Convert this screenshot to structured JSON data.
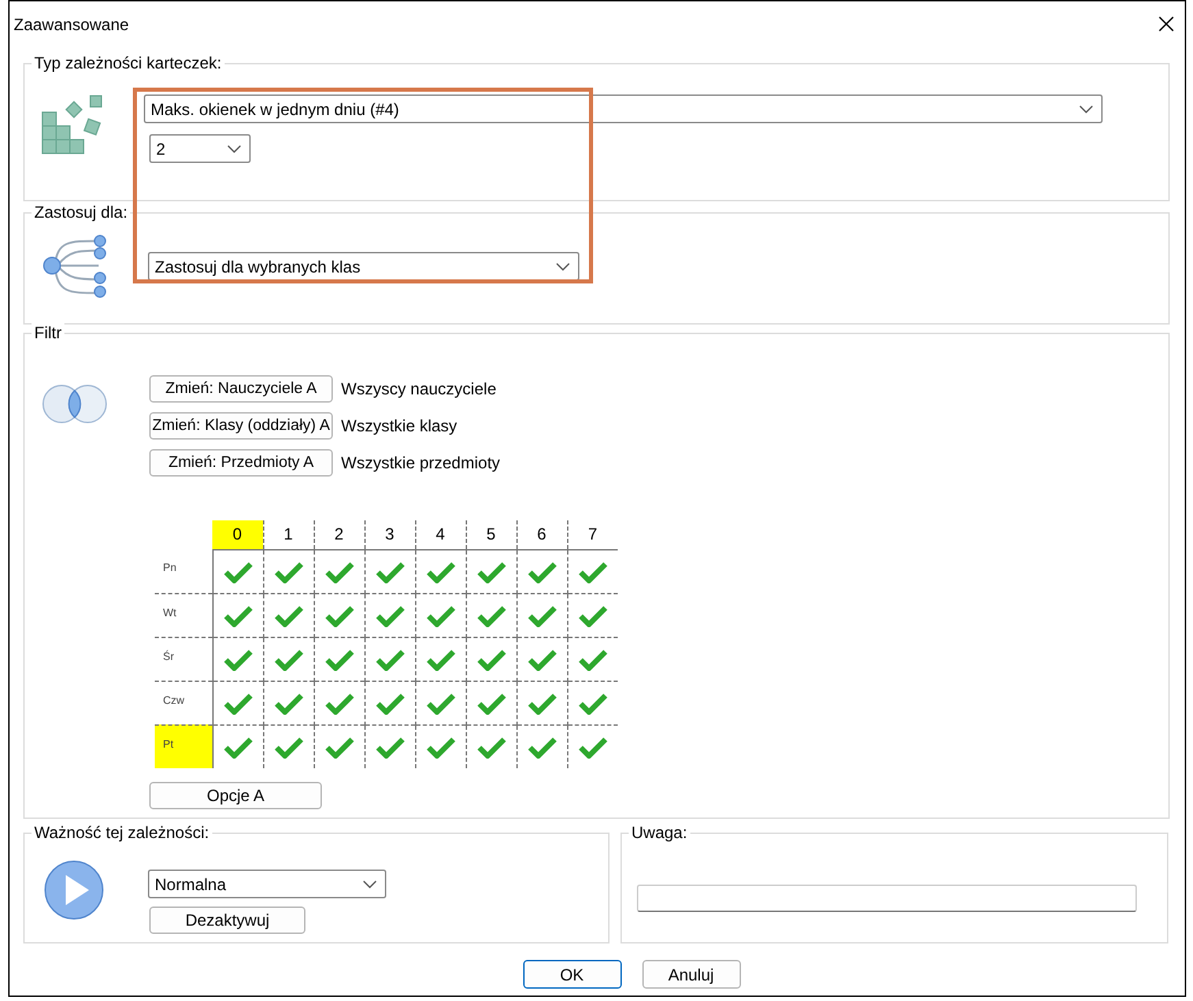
{
  "window": {
    "title": "Zaawansowane"
  },
  "type_group": {
    "legend": "Typ zależności karteczek:",
    "type_select": "Maks. okienek w jednym dniu (#4)",
    "value_select": "2"
  },
  "apply_group": {
    "legend": "Zastosuj dla:",
    "apply_select": "Zastosuj dla wybranych klas"
  },
  "filter": {
    "legend": "Filtr",
    "filters": [
      {
        "button": "Zmień: Nauczyciele A",
        "value": "Wszyscy nauczyciele"
      },
      {
        "button": "Zmień: Klasy (oddziały) A",
        "value": "Wszystkie klasy"
      },
      {
        "button": "Zmień: Przedmioty A",
        "value": "Wszystkie przedmioty"
      }
    ],
    "grid": {
      "columns": [
        {
          "label": "0",
          "selected": true
        },
        {
          "label": "1",
          "selected": false
        },
        {
          "label": "2",
          "selected": false
        },
        {
          "label": "3",
          "selected": false
        },
        {
          "label": "4",
          "selected": false
        },
        {
          "label": "5",
          "selected": false
        },
        {
          "label": "6",
          "selected": false
        },
        {
          "label": "7",
          "selected": false
        }
      ],
      "rows": [
        {
          "label": "Pn",
          "selected": false,
          "cells": [
            {
              "checked": true
            },
            {
              "checked": true
            },
            {
              "checked": true
            },
            {
              "checked": true
            },
            {
              "checked": true
            },
            {
              "checked": true
            },
            {
              "checked": true
            },
            {
              "checked": true
            }
          ]
        },
        {
          "label": "Wt",
          "selected": false,
          "cells": [
            {
              "checked": true
            },
            {
              "checked": true
            },
            {
              "checked": true
            },
            {
              "checked": true
            },
            {
              "checked": true
            },
            {
              "checked": true
            },
            {
              "checked": true
            },
            {
              "checked": true
            }
          ]
        },
        {
          "label": "Śr",
          "selected": false,
          "cells": [
            {
              "checked": true
            },
            {
              "checked": true
            },
            {
              "checked": true
            },
            {
              "checked": true
            },
            {
              "checked": true
            },
            {
              "checked": true
            },
            {
              "checked": true
            },
            {
              "checked": true
            }
          ]
        },
        {
          "label": "Czw",
          "selected": false,
          "cells": [
            {
              "checked": true
            },
            {
              "checked": true
            },
            {
              "checked": true
            },
            {
              "checked": true
            },
            {
              "checked": true
            },
            {
              "checked": true
            },
            {
              "checked": true
            },
            {
              "checked": true
            }
          ]
        },
        {
          "label": "Pt",
          "selected": true,
          "cells": [
            {
              "checked": true
            },
            {
              "checked": true
            },
            {
              "checked": true
            },
            {
              "checked": true
            },
            {
              "checked": true
            },
            {
              "checked": true
            },
            {
              "checked": true
            },
            {
              "checked": true
            }
          ]
        }
      ]
    },
    "options_button": "Opcje A"
  },
  "importance": {
    "legend": "Ważność tej zależności:",
    "select": "Normalna",
    "deactivate_button": "Dezaktywuj"
  },
  "note": {
    "legend": "Uwaga:"
  },
  "buttons": [
    {
      "label": "OK",
      "default": true
    },
    {
      "label": "Anuluj",
      "default": false
    }
  ]
}
